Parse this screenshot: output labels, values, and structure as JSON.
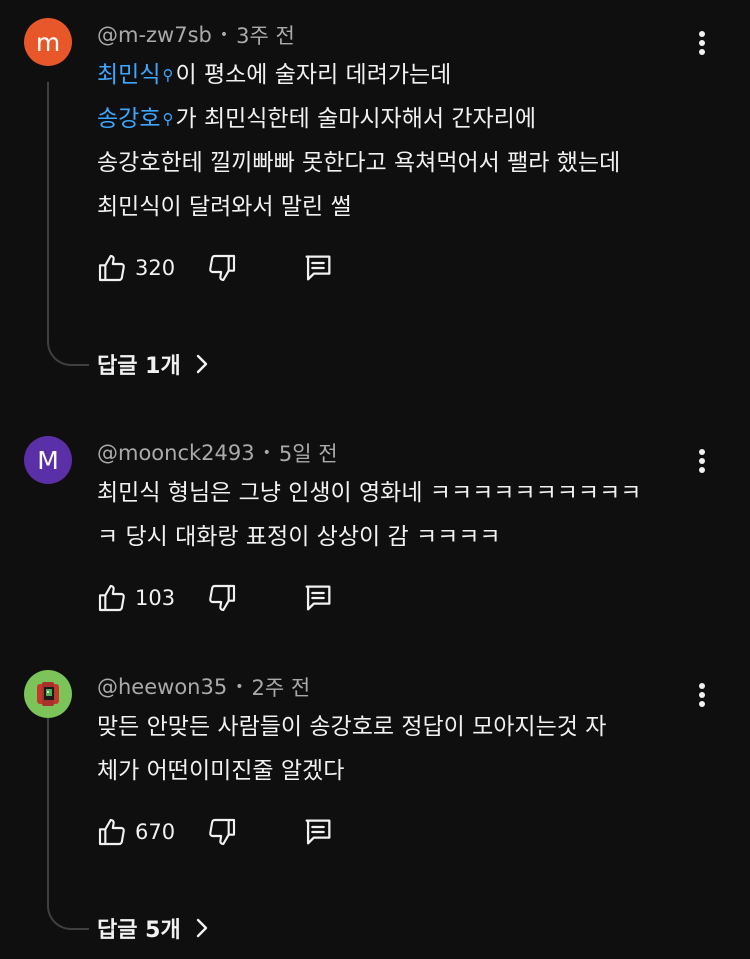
{
  "comments": [
    {
      "avatar_letter": "m",
      "avatar_color": "#e8572a",
      "handle": "@m-zw7sb",
      "time": "3주 전",
      "lines": [
        {
          "mention": "최민식",
          "text": "이 평소에 술자리 데려가는데"
        },
        {
          "mention": "송강호",
          "text": "가 최민식한테 술마시자해서 간자리에"
        },
        {
          "mention": "",
          "text": "송강호한테 낄끼빠빠 못한다고 욕쳐먹어서 팰라 했는데"
        },
        {
          "mention": "",
          "text": "최민식이 달려와서 말린 썰"
        }
      ],
      "likes": "320",
      "replies_label": "답글 1개"
    },
    {
      "avatar_letter": "M",
      "avatar_color": "#5b2fa8",
      "handle": "@moonck2493",
      "time": "5일 전",
      "lines": [
        {
          "mention": "",
          "text": "최민식 형님은 그냥 인생이 영화네 ㅋㅋㅋㅋㅋㅋㅋㅋㅋㅋ"
        },
        {
          "mention": "",
          "text": "ㅋ 당시 대화랑 표정이 상상이 감 ㅋㅋㅋㅋ"
        }
      ],
      "likes": "103"
    },
    {
      "avatar_letter": "",
      "avatar_color": "#7cc35a",
      "handle": "@heewon35",
      "time": "2주 전",
      "lines": [
        {
          "mention": "",
          "text": "맞든 안맞든 사람들이 송강호로 정답이 모아지는것 자"
        },
        {
          "mention": "",
          "text": "체가 어떤이미진줄 알겠다"
        }
      ],
      "likes": "670",
      "replies_label": "답글 5개"
    }
  ],
  "icons": {
    "like": "thumbs-up-icon",
    "dislike": "thumbs-down-icon",
    "reply": "comment-reply-icon",
    "more": "more-vert-icon",
    "chevron": "chevron-right-icon"
  }
}
